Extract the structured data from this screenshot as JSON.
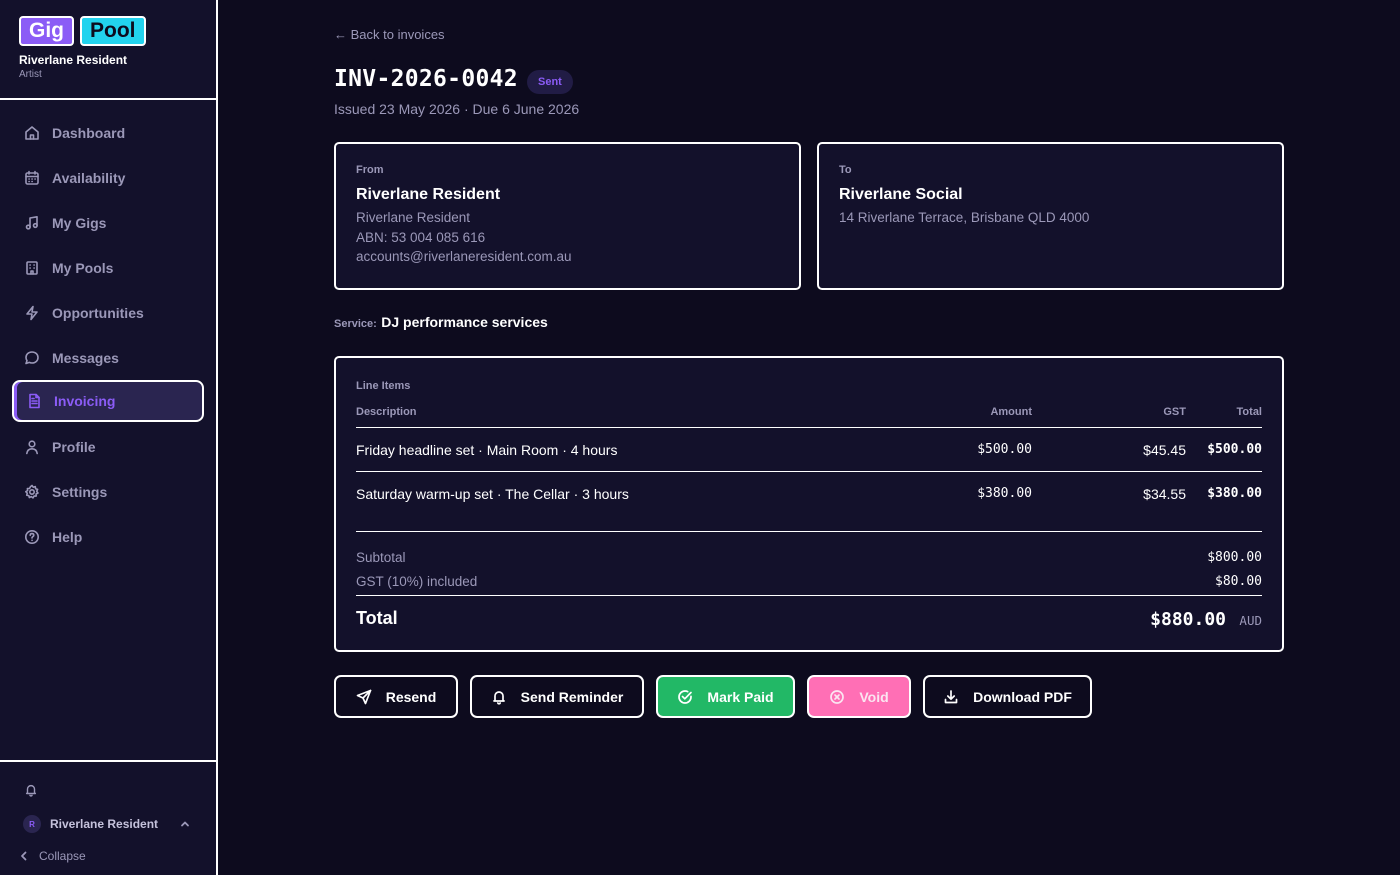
{
  "brand": {
    "logo_left": "Gig",
    "logo_right": "Pool",
    "account_name": "Riverlane Resident",
    "account_role": "Artist"
  },
  "nav": [
    {
      "label": "Dashboard",
      "icon": "home-icon"
    },
    {
      "label": "Availability",
      "icon": "calendar-icon"
    },
    {
      "label": "My Gigs",
      "icon": "music-note-icon"
    },
    {
      "label": "My Pools",
      "icon": "building-icon"
    },
    {
      "label": "Opportunities",
      "icon": "lightning-icon"
    },
    {
      "label": "Messages",
      "icon": "chat-bubble-icon"
    },
    {
      "label": "Invoicing",
      "icon": "document-icon",
      "active": true
    },
    {
      "label": "Profile",
      "icon": "user-icon"
    },
    {
      "label": "Settings",
      "icon": "gear-icon"
    },
    {
      "label": "Help",
      "icon": "help-circle-icon"
    }
  ],
  "footer": {
    "user_initial": "R",
    "user_name": "Riverlane Resident",
    "collapse_label": "Collapse"
  },
  "page": {
    "back_link": "← Back to invoices",
    "invoice_number": "INV-2026-0042",
    "status": "Sent",
    "dates": "Issued 23 May 2026 · Due 6 June 2026"
  },
  "from": {
    "label": "From",
    "name": "Riverlane Resident",
    "lines": [
      "Riverlane Resident",
      "ABN: 53 004 085 616",
      "accounts@riverlaneresident.com.au"
    ]
  },
  "to": {
    "label": "To",
    "name": "Riverlane Social",
    "lines": [
      "14 Riverlane Terrace, Brisbane QLD 4000"
    ]
  },
  "service": {
    "label": "Service:",
    "value": "DJ performance services"
  },
  "line_items": {
    "title": "Line Items",
    "headers": {
      "description": "Description",
      "amount": "Amount",
      "gst": "GST",
      "total": "Total"
    },
    "rows": [
      {
        "description": "Friday headline set · Main Room · 4 hours",
        "amount": "$500.00",
        "gst": "$45.45",
        "total": "$500.00"
      },
      {
        "description": "Saturday warm-up set · The Cellar · 3 hours",
        "amount": "$380.00",
        "gst": "$34.55",
        "total": "$380.00"
      }
    ],
    "subtotal_label": "Subtotal",
    "subtotal_value": "$800.00",
    "gst_label": "GST (10%) included",
    "gst_value": "$80.00",
    "total_label": "Total",
    "total_value": "$880.00",
    "currency": "AUD"
  },
  "actions": {
    "resend": "Resend",
    "send_reminder": "Send Reminder",
    "mark_paid": "Mark Paid",
    "void": "Void",
    "download_pdf": "Download PDF"
  },
  "colors": {
    "accent": "#8b5cf6",
    "brand_cyan": "#22d3ee",
    "success": "#22b866",
    "danger": "#ff6fb5",
    "background": "#0d0b1e",
    "panel": "#13112b"
  }
}
